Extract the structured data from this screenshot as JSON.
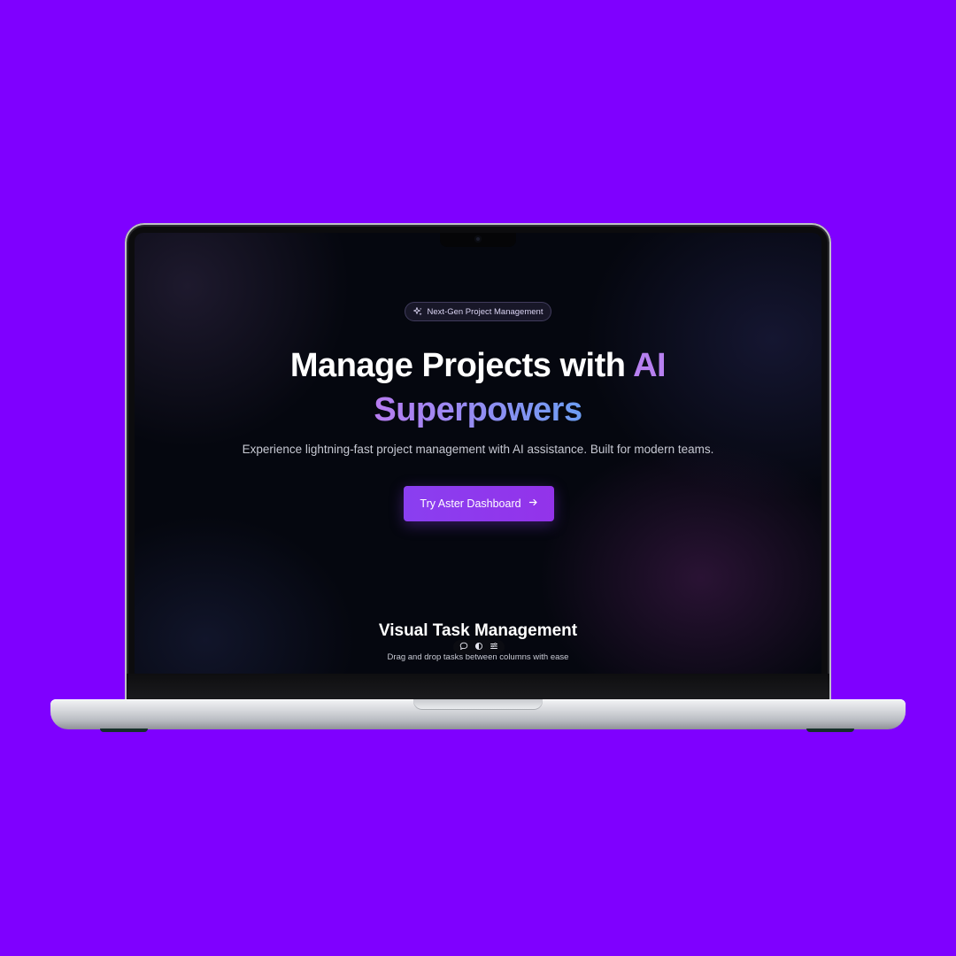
{
  "badge": {
    "icon": "sparkles-icon",
    "label": "Next-Gen Project Management"
  },
  "hero": {
    "title_part1": "Manage Projects with ",
    "title_accent_word": "AI",
    "title_part2": "Superpowers",
    "subtitle": "Experience lightning-fast project management with AI assistance. Built for modern teams.",
    "cta_label": "Try Aster Dashboard",
    "cta_icon": "arrow-right-icon"
  },
  "section": {
    "title": "Visual Task Management",
    "subtitle": "Drag and drop tasks between columns with ease"
  },
  "dev_toolbar": {
    "icons": [
      "comment-icon",
      "contrast-icon",
      "menu-icon"
    ]
  },
  "colors": {
    "page_background": "#7f00ff",
    "screen_background": "#05070f",
    "accent_purple": "#9333ea",
    "gradient_start": "#b77cf0",
    "gradient_end": "#6c9df2"
  }
}
